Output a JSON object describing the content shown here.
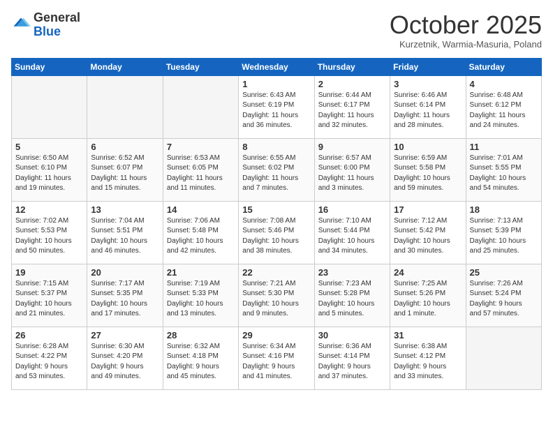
{
  "header": {
    "logo_general": "General",
    "logo_blue": "Blue",
    "month": "October 2025",
    "location": "Kurzetnik, Warmia-Masuria, Poland"
  },
  "weekdays": [
    "Sunday",
    "Monday",
    "Tuesday",
    "Wednesday",
    "Thursday",
    "Friday",
    "Saturday"
  ],
  "weeks": [
    [
      {
        "day": "",
        "info": ""
      },
      {
        "day": "",
        "info": ""
      },
      {
        "day": "",
        "info": ""
      },
      {
        "day": "1",
        "info": "Sunrise: 6:43 AM\nSunset: 6:19 PM\nDaylight: 11 hours\nand 36 minutes."
      },
      {
        "day": "2",
        "info": "Sunrise: 6:44 AM\nSunset: 6:17 PM\nDaylight: 11 hours\nand 32 minutes."
      },
      {
        "day": "3",
        "info": "Sunrise: 6:46 AM\nSunset: 6:14 PM\nDaylight: 11 hours\nand 28 minutes."
      },
      {
        "day": "4",
        "info": "Sunrise: 6:48 AM\nSunset: 6:12 PM\nDaylight: 11 hours\nand 24 minutes."
      }
    ],
    [
      {
        "day": "5",
        "info": "Sunrise: 6:50 AM\nSunset: 6:10 PM\nDaylight: 11 hours\nand 19 minutes."
      },
      {
        "day": "6",
        "info": "Sunrise: 6:52 AM\nSunset: 6:07 PM\nDaylight: 11 hours\nand 15 minutes."
      },
      {
        "day": "7",
        "info": "Sunrise: 6:53 AM\nSunset: 6:05 PM\nDaylight: 11 hours\nand 11 minutes."
      },
      {
        "day": "8",
        "info": "Sunrise: 6:55 AM\nSunset: 6:02 PM\nDaylight: 11 hours\nand 7 minutes."
      },
      {
        "day": "9",
        "info": "Sunrise: 6:57 AM\nSunset: 6:00 PM\nDaylight: 11 hours\nand 3 minutes."
      },
      {
        "day": "10",
        "info": "Sunrise: 6:59 AM\nSunset: 5:58 PM\nDaylight: 10 hours\nand 59 minutes."
      },
      {
        "day": "11",
        "info": "Sunrise: 7:01 AM\nSunset: 5:55 PM\nDaylight: 10 hours\nand 54 minutes."
      }
    ],
    [
      {
        "day": "12",
        "info": "Sunrise: 7:02 AM\nSunset: 5:53 PM\nDaylight: 10 hours\nand 50 minutes."
      },
      {
        "day": "13",
        "info": "Sunrise: 7:04 AM\nSunset: 5:51 PM\nDaylight: 10 hours\nand 46 minutes."
      },
      {
        "day": "14",
        "info": "Sunrise: 7:06 AM\nSunset: 5:48 PM\nDaylight: 10 hours\nand 42 minutes."
      },
      {
        "day": "15",
        "info": "Sunrise: 7:08 AM\nSunset: 5:46 PM\nDaylight: 10 hours\nand 38 minutes."
      },
      {
        "day": "16",
        "info": "Sunrise: 7:10 AM\nSunset: 5:44 PM\nDaylight: 10 hours\nand 34 minutes."
      },
      {
        "day": "17",
        "info": "Sunrise: 7:12 AM\nSunset: 5:42 PM\nDaylight: 10 hours\nand 30 minutes."
      },
      {
        "day": "18",
        "info": "Sunrise: 7:13 AM\nSunset: 5:39 PM\nDaylight: 10 hours\nand 25 minutes."
      }
    ],
    [
      {
        "day": "19",
        "info": "Sunrise: 7:15 AM\nSunset: 5:37 PM\nDaylight: 10 hours\nand 21 minutes."
      },
      {
        "day": "20",
        "info": "Sunrise: 7:17 AM\nSunset: 5:35 PM\nDaylight: 10 hours\nand 17 minutes."
      },
      {
        "day": "21",
        "info": "Sunrise: 7:19 AM\nSunset: 5:33 PM\nDaylight: 10 hours\nand 13 minutes."
      },
      {
        "day": "22",
        "info": "Sunrise: 7:21 AM\nSunset: 5:30 PM\nDaylight: 10 hours\nand 9 minutes."
      },
      {
        "day": "23",
        "info": "Sunrise: 7:23 AM\nSunset: 5:28 PM\nDaylight: 10 hours\nand 5 minutes."
      },
      {
        "day": "24",
        "info": "Sunrise: 7:25 AM\nSunset: 5:26 PM\nDaylight: 10 hours\nand 1 minute."
      },
      {
        "day": "25",
        "info": "Sunrise: 7:26 AM\nSunset: 5:24 PM\nDaylight: 9 hours\nand 57 minutes."
      }
    ],
    [
      {
        "day": "26",
        "info": "Sunrise: 6:28 AM\nSunset: 4:22 PM\nDaylight: 9 hours\nand 53 minutes."
      },
      {
        "day": "27",
        "info": "Sunrise: 6:30 AM\nSunset: 4:20 PM\nDaylight: 9 hours\nand 49 minutes."
      },
      {
        "day": "28",
        "info": "Sunrise: 6:32 AM\nSunset: 4:18 PM\nDaylight: 9 hours\nand 45 minutes."
      },
      {
        "day": "29",
        "info": "Sunrise: 6:34 AM\nSunset: 4:16 PM\nDaylight: 9 hours\nand 41 minutes."
      },
      {
        "day": "30",
        "info": "Sunrise: 6:36 AM\nSunset: 4:14 PM\nDaylight: 9 hours\nand 37 minutes."
      },
      {
        "day": "31",
        "info": "Sunrise: 6:38 AM\nSunset: 4:12 PM\nDaylight: 9 hours\nand 33 minutes."
      },
      {
        "day": "",
        "info": ""
      }
    ]
  ]
}
